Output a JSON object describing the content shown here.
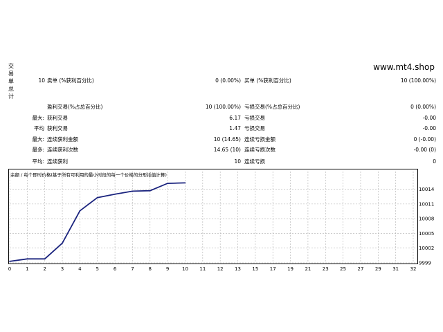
{
  "side_tab": [
    "交",
    "易",
    "单",
    "总",
    "计"
  ],
  "site": "www.mt4.shop",
  "report": {
    "total_count": "10",
    "sell_label": "卖单 (%获利百分比)",
    "sell_value": "0 (0.00%)",
    "buy_label": "买单 (%获利百分比)",
    "buy_value": "10 (100.00%)",
    "profit_trades_label": "盈利交易(%占总百分比)",
    "profit_trades_value": "10 (100.00%)",
    "loss_trades_label": "亏损交易(%占总百分比)",
    "loss_trades_value": "0 (0.00%)",
    "max_label": "最大:",
    "avg_label": "平均",
    "largest_profit_label": "获利交易",
    "largest_profit_value": "6.17",
    "largest_loss_label": "亏损交易",
    "largest_loss_value": "-0.00",
    "avg_profit_label": "获利交易",
    "avg_profit_value": "1.47",
    "avg_loss_label": "亏损交易",
    "avg_loss_value": "-0.00",
    "max2_label": "最大:",
    "consec_wins_amount_label": "连续获利金额",
    "consec_wins_amount_value": "10 (14.65)",
    "consec_losses_amount_label": "连续亏损金额",
    "consec_losses_amount_value": "0 (-0.00)",
    "most_label": "最多:",
    "consec_profit_count_label": "连续获利次数",
    "consec_profit_count_value": "14.65 (10)",
    "consec_loss_count_label": "连续亏损次数",
    "consec_loss_count_value": "-0.00 (0)",
    "avg2_label": "平均:",
    "avg_consec_wins_label": "连续获利",
    "avg_consec_wins_value": "10",
    "avg_consec_losses_label": "连续亏损",
    "avg_consec_losses_value": "0"
  },
  "chart_title": "余额 / 每个即时价格(基于所有可利用的最小时段的每一个价格的分形插值计算)",
  "chart_data": {
    "type": "line",
    "x": [
      0,
      1,
      2,
      3,
      4,
      5,
      6,
      7,
      8,
      9,
      10
    ],
    "series": [
      {
        "values": [
          9999.3,
          9999.8,
          9999.8,
          10003.0,
          10009.6,
          10012.3,
          10013.0,
          10013.6,
          10013.7,
          10015.2,
          10015.3
        ]
      }
    ],
    "xticks": [
      "0",
      "1",
      "2",
      "3",
      "4",
      "5",
      "6",
      "7",
      "8",
      "9",
      "10",
      "11",
      "12",
      "13",
      "15",
      "17",
      "19",
      "21",
      "23",
      "25",
      "27",
      "29",
      "31",
      "32"
    ],
    "ytick_labels": [
      "10014",
      "10011",
      "10008",
      "10005",
      "10002",
      "9999"
    ],
    "yticks": [
      10014,
      10011,
      10008,
      10005,
      10002,
      9999
    ],
    "ylim": [
      9999,
      10016.2
    ],
    "line_color": "#1a237e",
    "grid": true
  }
}
